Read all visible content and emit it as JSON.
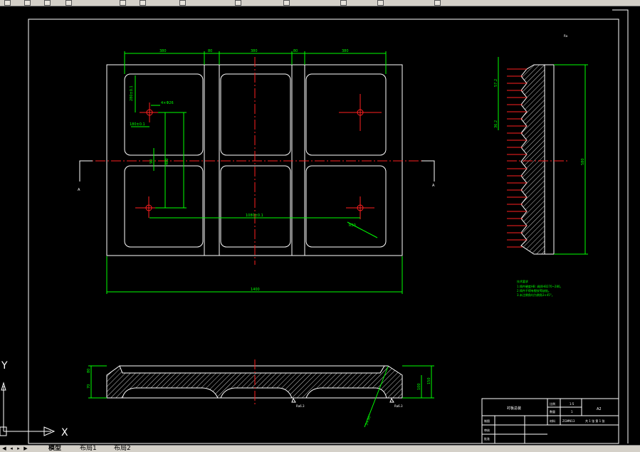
{
  "toolbar": {
    "icons": [
      "new-icon",
      "open-icon",
      "save-icon",
      "print-icon",
      "undo-icon",
      "redo-icon",
      "layer-icon",
      "properties-icon",
      "match-icon",
      "zoom-icon",
      "pan-icon",
      "help-icon"
    ]
  },
  "drawing": {
    "dims_top": [
      "380",
      "80",
      "380",
      "80",
      "380"
    ],
    "dim_bottom_total": "1400",
    "hole_callout": "4×Φ26",
    "hole_spacing": "1080±0.1",
    "dim_v1": "280±0.1",
    "dim_h1": "180±0.1",
    "dim_v_small": "90",
    "dim_v_center": "480",
    "dim_r": "R50",
    "section_label_left": "A",
    "section_label_right": "A",
    "top_right_note": "Ra",
    "side_dim_1": "57.2",
    "side_dim_2": "36.2",
    "side_dim_total": "580",
    "front_dim_1": "80",
    "front_dim_2": "70",
    "front_dim_3": "150",
    "front_dim_4": "100",
    "front_roughness_1": "Ra6.3",
    "front_roughness_2": "Ra6.3",
    "front_leader": "3×30°",
    "notes_title": "技术要求",
    "notes": [
      "1.铸件硬度HB: 调质HB270~280。",
      "2.铸件不得有裂纹等缺陷。",
      "3.未注倒角均为倒角3×45°。"
    ]
  },
  "title_block": {
    "part_name": "衬板总装",
    "scale_label": "比例",
    "scale_value": "1:5",
    "qty_label": "数量",
    "qty_value": "1",
    "material_label": "材料",
    "material_value": "ZGMN13",
    "sheet_info": "共 1 张  第 1 张",
    "size": "A2",
    "drawn_label": "制图",
    "checked_label": "审核",
    "approved_label": "批准"
  },
  "ucs": {
    "y_label": "Y",
    "x_label": "X"
  },
  "layout_tabs": {
    "model": "模型",
    "layout1": "布局1",
    "layout2": "布局2"
  }
}
